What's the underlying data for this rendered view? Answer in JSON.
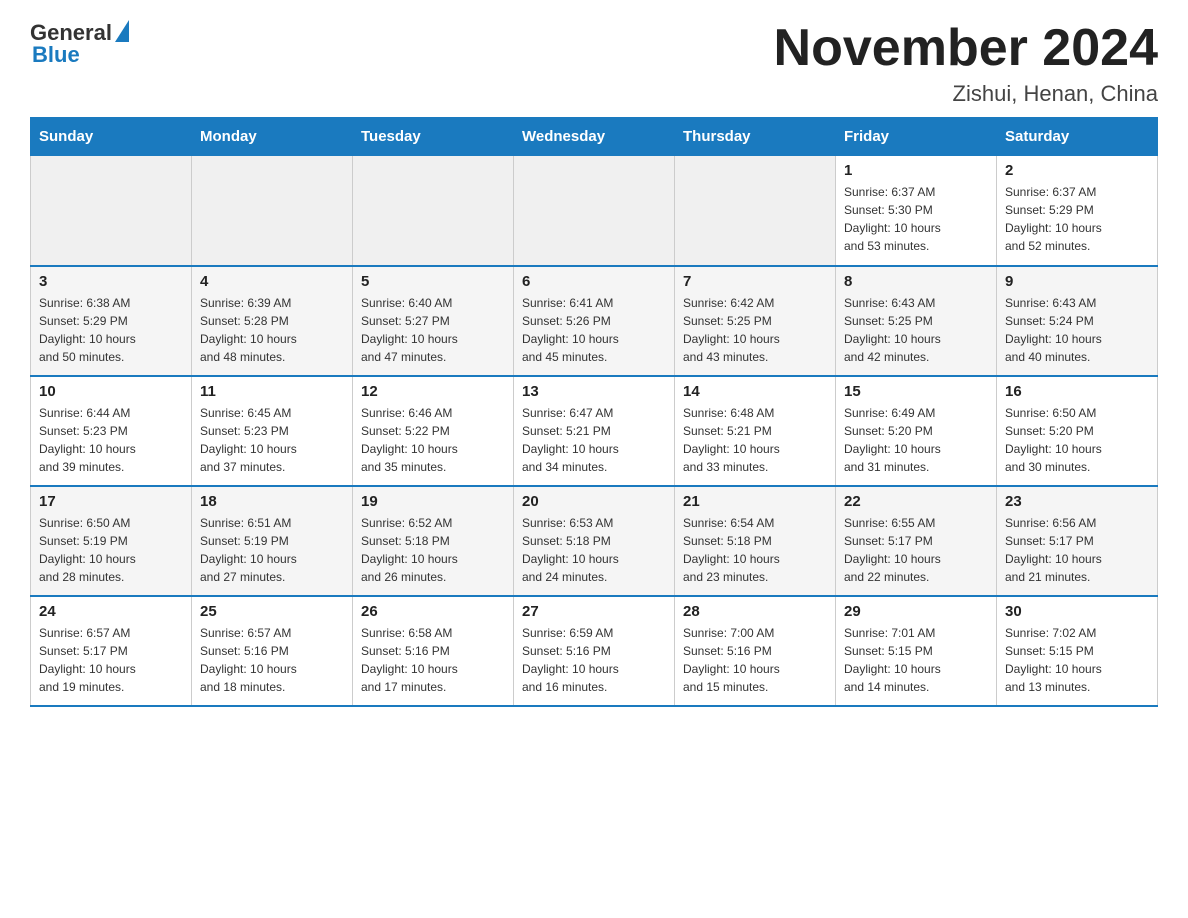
{
  "header": {
    "logo_general": "General",
    "logo_blue": "Blue",
    "month_title": "November 2024",
    "location": "Zishui, Henan, China"
  },
  "days_of_week": [
    "Sunday",
    "Monday",
    "Tuesday",
    "Wednesday",
    "Thursday",
    "Friday",
    "Saturday"
  ],
  "weeks": [
    [
      {
        "day": "",
        "info": ""
      },
      {
        "day": "",
        "info": ""
      },
      {
        "day": "",
        "info": ""
      },
      {
        "day": "",
        "info": ""
      },
      {
        "day": "",
        "info": ""
      },
      {
        "day": "1",
        "info": "Sunrise: 6:37 AM\nSunset: 5:30 PM\nDaylight: 10 hours\nand 53 minutes."
      },
      {
        "day": "2",
        "info": "Sunrise: 6:37 AM\nSunset: 5:29 PM\nDaylight: 10 hours\nand 52 minutes."
      }
    ],
    [
      {
        "day": "3",
        "info": "Sunrise: 6:38 AM\nSunset: 5:29 PM\nDaylight: 10 hours\nand 50 minutes."
      },
      {
        "day": "4",
        "info": "Sunrise: 6:39 AM\nSunset: 5:28 PM\nDaylight: 10 hours\nand 48 minutes."
      },
      {
        "day": "5",
        "info": "Sunrise: 6:40 AM\nSunset: 5:27 PM\nDaylight: 10 hours\nand 47 minutes."
      },
      {
        "day": "6",
        "info": "Sunrise: 6:41 AM\nSunset: 5:26 PM\nDaylight: 10 hours\nand 45 minutes."
      },
      {
        "day": "7",
        "info": "Sunrise: 6:42 AM\nSunset: 5:25 PM\nDaylight: 10 hours\nand 43 minutes."
      },
      {
        "day": "8",
        "info": "Sunrise: 6:43 AM\nSunset: 5:25 PM\nDaylight: 10 hours\nand 42 minutes."
      },
      {
        "day": "9",
        "info": "Sunrise: 6:43 AM\nSunset: 5:24 PM\nDaylight: 10 hours\nand 40 minutes."
      }
    ],
    [
      {
        "day": "10",
        "info": "Sunrise: 6:44 AM\nSunset: 5:23 PM\nDaylight: 10 hours\nand 39 minutes."
      },
      {
        "day": "11",
        "info": "Sunrise: 6:45 AM\nSunset: 5:23 PM\nDaylight: 10 hours\nand 37 minutes."
      },
      {
        "day": "12",
        "info": "Sunrise: 6:46 AM\nSunset: 5:22 PM\nDaylight: 10 hours\nand 35 minutes."
      },
      {
        "day": "13",
        "info": "Sunrise: 6:47 AM\nSunset: 5:21 PM\nDaylight: 10 hours\nand 34 minutes."
      },
      {
        "day": "14",
        "info": "Sunrise: 6:48 AM\nSunset: 5:21 PM\nDaylight: 10 hours\nand 33 minutes."
      },
      {
        "day": "15",
        "info": "Sunrise: 6:49 AM\nSunset: 5:20 PM\nDaylight: 10 hours\nand 31 minutes."
      },
      {
        "day": "16",
        "info": "Sunrise: 6:50 AM\nSunset: 5:20 PM\nDaylight: 10 hours\nand 30 minutes."
      }
    ],
    [
      {
        "day": "17",
        "info": "Sunrise: 6:50 AM\nSunset: 5:19 PM\nDaylight: 10 hours\nand 28 minutes."
      },
      {
        "day": "18",
        "info": "Sunrise: 6:51 AM\nSunset: 5:19 PM\nDaylight: 10 hours\nand 27 minutes."
      },
      {
        "day": "19",
        "info": "Sunrise: 6:52 AM\nSunset: 5:18 PM\nDaylight: 10 hours\nand 26 minutes."
      },
      {
        "day": "20",
        "info": "Sunrise: 6:53 AM\nSunset: 5:18 PM\nDaylight: 10 hours\nand 24 minutes."
      },
      {
        "day": "21",
        "info": "Sunrise: 6:54 AM\nSunset: 5:18 PM\nDaylight: 10 hours\nand 23 minutes."
      },
      {
        "day": "22",
        "info": "Sunrise: 6:55 AM\nSunset: 5:17 PM\nDaylight: 10 hours\nand 22 minutes."
      },
      {
        "day": "23",
        "info": "Sunrise: 6:56 AM\nSunset: 5:17 PM\nDaylight: 10 hours\nand 21 minutes."
      }
    ],
    [
      {
        "day": "24",
        "info": "Sunrise: 6:57 AM\nSunset: 5:17 PM\nDaylight: 10 hours\nand 19 minutes."
      },
      {
        "day": "25",
        "info": "Sunrise: 6:57 AM\nSunset: 5:16 PM\nDaylight: 10 hours\nand 18 minutes."
      },
      {
        "day": "26",
        "info": "Sunrise: 6:58 AM\nSunset: 5:16 PM\nDaylight: 10 hours\nand 17 minutes."
      },
      {
        "day": "27",
        "info": "Sunrise: 6:59 AM\nSunset: 5:16 PM\nDaylight: 10 hours\nand 16 minutes."
      },
      {
        "day": "28",
        "info": "Sunrise: 7:00 AM\nSunset: 5:16 PM\nDaylight: 10 hours\nand 15 minutes."
      },
      {
        "day": "29",
        "info": "Sunrise: 7:01 AM\nSunset: 5:15 PM\nDaylight: 10 hours\nand 14 minutes."
      },
      {
        "day": "30",
        "info": "Sunrise: 7:02 AM\nSunset: 5:15 PM\nDaylight: 10 hours\nand 13 minutes."
      }
    ]
  ]
}
